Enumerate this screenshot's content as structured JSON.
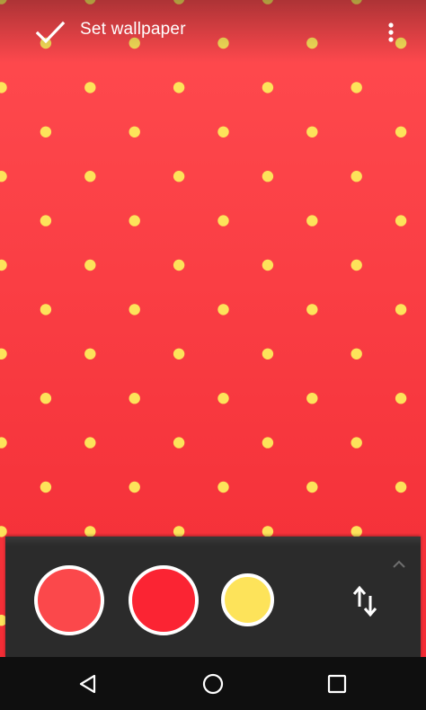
{
  "toolbar": {
    "title": "Set wallpaper",
    "confirm_icon": "check-icon",
    "menu_icon": "more-vert-icon"
  },
  "wallpaper": {
    "pattern": "polka-dots",
    "background_color_top": "#ff4b4f",
    "background_color_bottom": "#f22a33",
    "dot_color": "#fde35a"
  },
  "color_panel": {
    "swatches": [
      {
        "name": "color-1",
        "color": "#fb484b"
      },
      {
        "name": "color-2",
        "color": "#fb2433"
      },
      {
        "name": "color-3",
        "color": "#fde35a"
      }
    ],
    "swap_icon": "swap-vert-icon",
    "collapse_icon": "chevron-up-icon",
    "background": "#2b2b2b"
  },
  "navigation_bar": {
    "back_icon": "back-triangle-icon",
    "home_icon": "home-circle-icon",
    "recents_icon": "recents-square-icon"
  }
}
